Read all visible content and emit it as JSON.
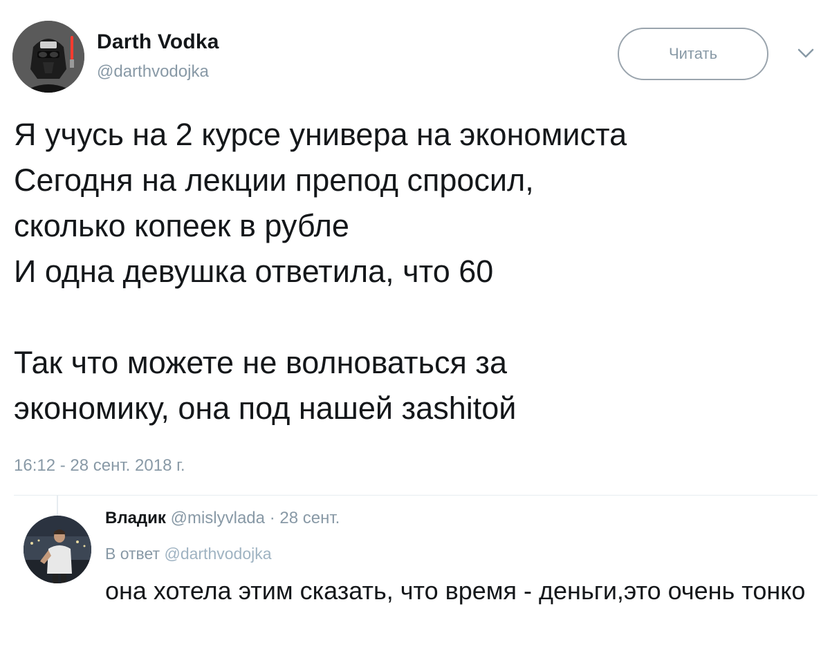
{
  "tweet": {
    "author_name": "Darth Vodka",
    "author_handle": "@darthvodojka",
    "avatar_icon": "darth-vader-avatar-icon",
    "follow_label": "Читать",
    "menu_icon": "chevron-down-icon",
    "text": "Я учусь на 2 курсе универа на экономиста\nСегодня на лекции препод спросил,\nсколько копеек в рубле\nИ одна девушка ответила, что 60\n\nТак что можете не волноваться за\nэкономику, она под нашей заshitой",
    "timestamp": "16:12 - 28 сент. 2018 г."
  },
  "reply": {
    "author_name": "Владик",
    "author_handle": "@mislyvlada",
    "separator": "·",
    "date": "28 сент.",
    "reply_to_label": "В ответ",
    "reply_to_handle": "@darthvodojka",
    "text": "она хотела этим сказать, что время - деньги,это очень тонко"
  },
  "colors": {
    "text_primary": "#14171a",
    "text_secondary": "#8899a6",
    "divider": "#e6ecf0",
    "button_border": "#9aa4ad"
  }
}
